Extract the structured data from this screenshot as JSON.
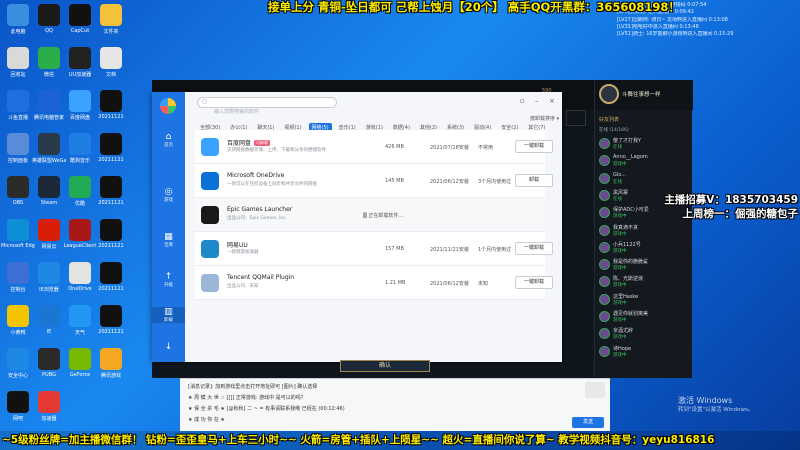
{
  "overlay": {
    "top_banner": "接单上分 青铜-坠日都可 己帮上蚀月【20个】  高手QQ开黑群：365608198！",
    "bottom_ticker": "~5级粉丝牌=加主播微信群！ 钻粉=歪歪皇马+上车三小时~~  火箭=房管+插队+上陨星~~  超火=直播间你说了算~  教学视频抖音号：yeyu816816",
    "streamer_line1": "主播招募V：1835703459",
    "streamer_line2": "上周榜一：倔强的糖包子",
    "chat_feed": [
      "andMar叫进入直播间 · 野钱码 0:07:54",
      "[LV6]长弹剑: 进入直播间 0:09:42",
      "[LV27]坦朗阿: 骑日~ 龙场啊进入直播间 0:13:08",
      "[LV31]哈哈好中进入直播间 0:13:48",
      "[LV51]骑士: 16岁能聊小游戏啊进入直播间 0:15:29"
    ]
  },
  "desktop_icons": [
    {
      "label": "此电脑",
      "color": "#3a8fe0"
    },
    {
      "label": "QQ",
      "color": "#1a1a1a"
    },
    {
      "label": "CapCut",
      "color": "#111111"
    },
    {
      "label": "文件夹",
      "color": "#f3c13a"
    },
    {
      "label": "回收站",
      "color": "#d9d9d9"
    },
    {
      "label": "微信",
      "color": "#2aae4a"
    },
    {
      "label": "UU加速器",
      "color": "#222222"
    },
    {
      "label": "文档",
      "color": "#e6e6e6"
    },
    {
      "label": "斗鱼直播",
      "color": "#1f6fe0"
    },
    {
      "label": "腾讯电脑管家",
      "color": "#1c62d6"
    },
    {
      "label": "百度网盘",
      "color": "#3aa3ff"
    },
    {
      "label": "20211121",
      "color": "#111111"
    },
    {
      "label": "控制面板",
      "color": "#5a8bd8"
    },
    {
      "label": "英雄联盟WeGame",
      "color": "#2a3a4a"
    },
    {
      "label": "酷狗音乐",
      "color": "#1d7fe4"
    },
    {
      "label": "20211121",
      "color": "#111111"
    },
    {
      "label": "OBS",
      "color": "#2b2b2b"
    },
    {
      "label": "Steam",
      "color": "#1b2838"
    },
    {
      "label": "优酷",
      "color": "#22aa55"
    },
    {
      "label": "20211121",
      "color": "#111111"
    },
    {
      "label": "Microsoft Edge",
      "color": "#0f8fd6"
    },
    {
      "label": "网易云",
      "color": "#d81e06"
    },
    {
      "label": "LeagueClient",
      "color": "#a81818"
    },
    {
      "label": "20211121",
      "color": "#111111"
    },
    {
      "label": "控制台",
      "color": "#3d6fd6"
    },
    {
      "label": "IE浏览器",
      "color": "#1e88e5"
    },
    {
      "label": "OneDrive",
      "color": "#e3e3e3"
    },
    {
      "label": "20211121",
      "color": "#111111"
    },
    {
      "label": "小黄鸭",
      "color": "#f2c500"
    },
    {
      "label": "IE",
      "color": "#1976d2"
    },
    {
      "label": "天气",
      "color": "#2196f3"
    },
    {
      "label": "20211121",
      "color": "#111111"
    },
    {
      "label": "安全中心",
      "color": "#1e88e5"
    },
    {
      "label": "PUBG",
      "color": "#2a2a2a"
    },
    {
      "label": "GeForce",
      "color": "#76b900"
    },
    {
      "label": "腾讯游戏",
      "color": "#f5a623"
    },
    {
      "label": "网吧",
      "color": "#111111"
    },
    {
      "label": "加速器",
      "color": "#e53935"
    }
  ],
  "app": {
    "search_placeholder": "输入您要搜索的软件",
    "sidebar": [
      {
        "icon": "⌂",
        "label": "首页"
      },
      {
        "icon": "◎",
        "label": "游戏"
      },
      {
        "icon": "▦",
        "label": "宝库"
      },
      {
        "icon": "↑",
        "label": "升级"
      },
      {
        "icon": "▥",
        "label": "卸载"
      },
      {
        "icon": "↓",
        "label": ""
      }
    ],
    "tabs": [
      "全部(30)",
      "办公(1)",
      "聊天(1)",
      "视频(1)",
      "网络(5)",
      "音乐(1)",
      "游戏(1)",
      "数据(4)",
      "其他(2)",
      "系统(3)",
      "驱动(4)",
      "安全(2)",
      "其它(7)"
    ],
    "active_tab_index": 4,
    "sort_label": "按卸载排序",
    "rows": [
      {
        "name": "百度网盘",
        "tag": "可卸载",
        "desc": "支持网盘数据存储、上传、下载和分享的便捷软件",
        "size": "426 MB",
        "date": "2021/07/18安装",
        "freq": "不常用",
        "button": "一键卸载",
        "icon_color": "#3aa3ff"
      },
      {
        "name": "Microsoft OneDrive",
        "tag": "",
        "desc": "一款可以在任何设备上同步和共享文件的网盘",
        "size": "145 MB",
        "date": "2021/06/12安装",
        "freq": "3个月内使用过",
        "button": "卸载",
        "icon_color": "#0a72d6"
      },
      {
        "name": "Epic Games Launcher",
        "tag": "",
        "desc": "出品公司：Epic Games, Inc.",
        "size": "",
        "date": "",
        "freq": "",
        "button": "",
        "uninstalling": "正在卸载软件...",
        "icon_color": "#1a1a1a"
      },
      {
        "name": "网易UU",
        "tag": "",
        "desc": "一款网游加速器",
        "size": "157 MB",
        "date": "2021/11/21安装",
        "freq": "1个月内使用过",
        "button": "一键卸载",
        "icon_color": "#1e88c8"
      },
      {
        "name": "Tencent QQMail Plugin",
        "tag": "",
        "desc": "出品公司：未知",
        "size": "1.21 MB",
        "date": "2021/06/12安装",
        "freq": "未知",
        "button": "一键卸载",
        "icon_color": "#9ab7d8"
      }
    ]
  },
  "game": {
    "title": "斗舞往事想一样",
    "currency1": "590",
    "currency2": "1180",
    "friends_title": "好友列表",
    "friends_group": "在线 (14/166)",
    "confirm_label": "确认",
    "friends": [
      {
        "name": "傻了才打我Y",
        "status": "在线"
      },
      {
        "name": "Anno__Lagom",
        "status": "游戏中"
      },
      {
        "name": "Glo...",
        "status": "在线"
      },
      {
        "name": "黑风寨",
        "status": "在线"
      },
      {
        "name": "保护ADC小可爱",
        "status": "游戏中"
      },
      {
        "name": "我真滴不贪",
        "status": "游戏中"
      },
      {
        "name": "小兵1122号",
        "status": "游戏中"
      },
      {
        "name": "我是你的脆脆鲨",
        "status": "游戏中"
      },
      {
        "name": "陈、光斯逆浪",
        "status": "游戏中"
      },
      {
        "name": "这里Haske",
        "status": "游戏中"
      },
      {
        "name": "遇见你就别离美",
        "status": "游戏中"
      },
      {
        "name": "京酒尤醉",
        "status": "游戏中"
      },
      {
        "name": "诗Hope",
        "status": "游戏中"
      }
    ]
  },
  "qq": {
    "lines": [
      "[消息记录]: 加到游戏里点击打开地址即可  [图片] 确认选择",
      "★ 周 模 大 世 ☆  [[]]  正常游戏: 游戏中  是可以的吗？",
      "★ 保 全 杀 毛 ★  [@秋秋]  二 ~ = 有事请联系我哦  已经在 (00:12:46)",
      "★ 成 功 你 在 ★"
    ],
    "send_label": "发送"
  },
  "activation": {
    "line1": "激活 Windows",
    "line2": "转到\"设置\"以激活 Windows。"
  }
}
